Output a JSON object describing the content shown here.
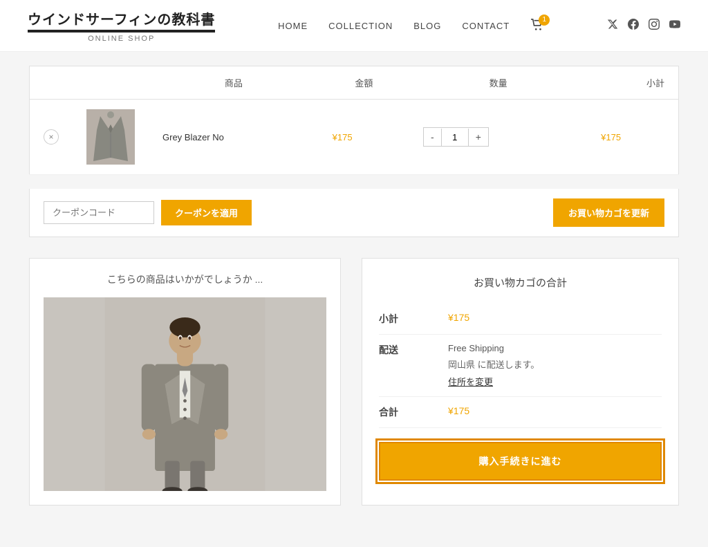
{
  "header": {
    "logo_title": "ウインドサーフィンの教科書",
    "logo_subtitle": "ONLINE SHOP",
    "nav": [
      {
        "label": "HOME",
        "id": "home"
      },
      {
        "label": "COLLECTION",
        "id": "collection"
      },
      {
        "label": "BLOG",
        "id": "blog"
      },
      {
        "label": "CONTACT",
        "id": "contact"
      }
    ],
    "cart_count": "1"
  },
  "cart": {
    "columns": {
      "product": "商品",
      "price": "金額",
      "qty": "数量",
      "subtotal": "小計"
    },
    "items": [
      {
        "name": "Grey Blazer No",
        "price": "¥175",
        "qty": "1",
        "subtotal": "¥175"
      }
    ]
  },
  "coupon": {
    "placeholder": "クーポンコード",
    "apply_label": "クーポンを適用",
    "update_label": "お買い物カゴを更新"
  },
  "suggestions": {
    "title": "こちらの商品はいかがでしょうか ..."
  },
  "totals": {
    "title": "お買い物カゴの合計",
    "subtotal_label": "小計",
    "subtotal_value": "¥175",
    "shipping_label": "配送",
    "shipping_method": "Free Shipping",
    "shipping_region": "岡山県 に配送します。",
    "change_address": "住所を変更",
    "total_label": "合計",
    "total_value": "¥175",
    "checkout_label": "購入手続きに進む"
  }
}
